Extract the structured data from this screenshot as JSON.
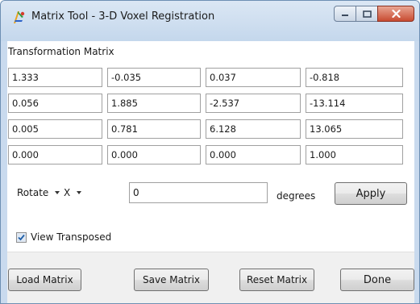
{
  "window": {
    "title": "Matrix Tool - 3-D Voxel Registration",
    "icon": "matrix-tool-app-icon",
    "controls": [
      "minimize-icon",
      "maximize-icon",
      "close-icon"
    ]
  },
  "matrix": {
    "label": "Transformation Matrix",
    "rows": [
      [
        "1.333",
        "-0.035",
        "0.037",
        "-0.818"
      ],
      [
        "0.056",
        "1.885",
        "-2.537",
        "-13.114"
      ],
      [
        "0.005",
        "0.781",
        "6.128",
        "13.065"
      ],
      [
        "0.000",
        "0.000",
        "0.000",
        "1.000"
      ]
    ]
  },
  "operation": {
    "mode_value": "Rotate",
    "axis_value": "X",
    "amount": "0",
    "unit_label": "degrees",
    "apply_label": "Apply"
  },
  "options": {
    "view_transposed_label": "View Transposed",
    "view_transposed_checked": true
  },
  "footer": {
    "load_label": "Load Matrix",
    "save_label": "Save Matrix",
    "reset_label": "Reset Matrix",
    "done_label": "Done"
  },
  "colors": {
    "titlebar": "#c9daee",
    "close_button": "#c84b31",
    "checkbox_tick": "#1f5fa8"
  }
}
